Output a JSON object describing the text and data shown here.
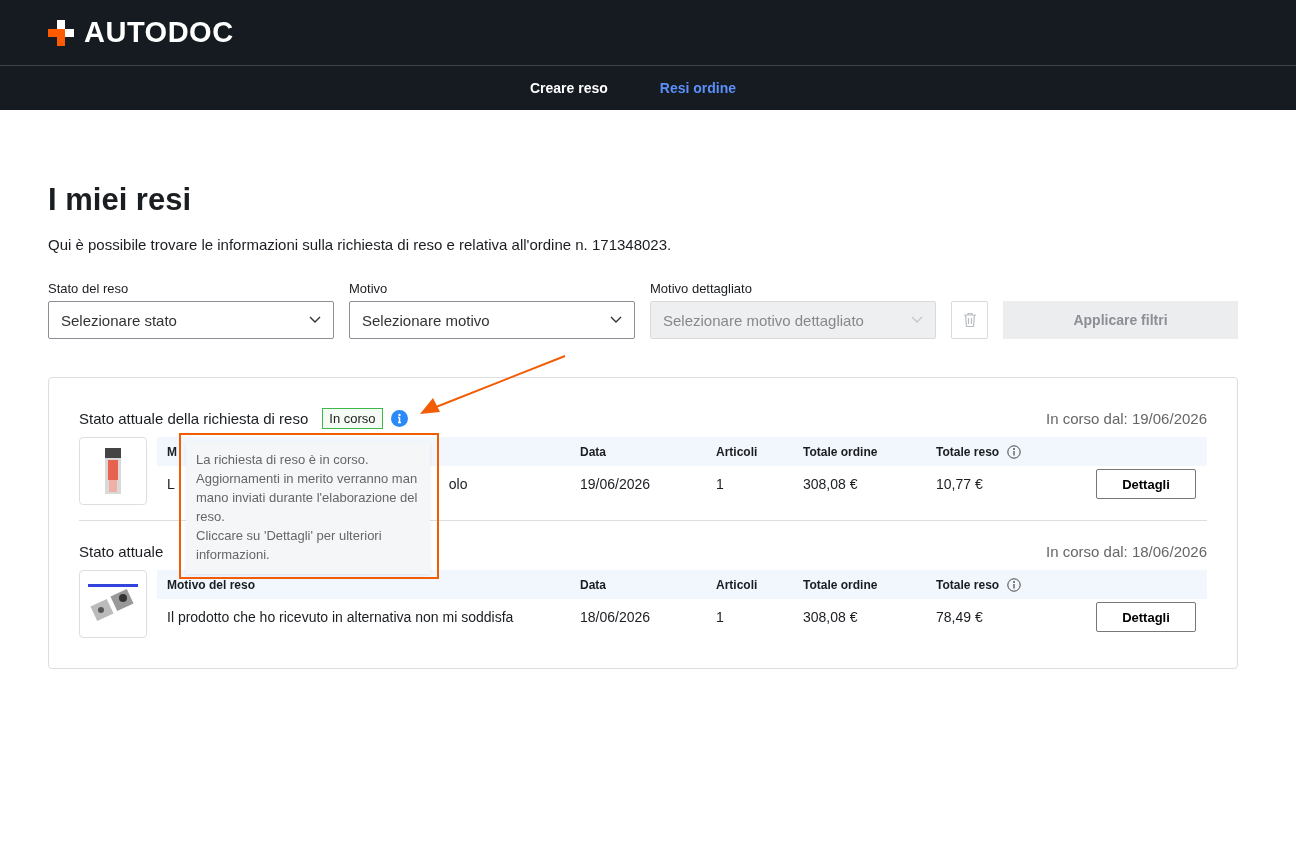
{
  "header": {
    "logo": "AUTODOC"
  },
  "nav": [
    {
      "label": "Creare reso",
      "selected": false
    },
    {
      "label": "Resi ordine",
      "selected": true
    }
  ],
  "page": {
    "title": "I miei resi",
    "description": "Qui è possibile trovare le informazioni sulla richiesta di reso e relativa all'ordine n. 171348023."
  },
  "filters": [
    {
      "label": "Stato del reso",
      "placeholder": "Selezionare stato",
      "disabled": false
    },
    {
      "label": "Motivo",
      "placeholder": "Selezionare motivo",
      "disabled": false
    },
    {
      "label": "Motivo dettagliato",
      "placeholder": "Selezionare motivo dettagliato",
      "disabled": true
    }
  ],
  "clear_button": {
    "disabled": true
  },
  "apply_button": {
    "label": "Applicare filtri",
    "disabled": true
  },
  "returns": [
    {
      "status_title": "Stato attuale della richiesta di reso",
      "status_badge": "In corso",
      "since": "In corso dal: 19/06/2026",
      "columns": [
        "M",
        "Data",
        "Articoli",
        "Totale ordine",
        "Totale reso"
      ],
      "row": {
        "reason": "L",
        "reason_tail": "olo",
        "date": "19/06/2026",
        "items": "1",
        "order_total": "308,08 €",
        "return_total": "10,77 €"
      },
      "button": "Dettagli"
    },
    {
      "status_title": "Stato attuale",
      "since": "In corso dal: 18/06/2026",
      "columns": [
        "Motivo del reso",
        "Data",
        "Articoli",
        "Totale ordine",
        "Totale reso"
      ],
      "row": {
        "reason": "Il prodotto che ho ricevuto in alternativa non mi soddisfa",
        "date": "18/06/2026",
        "items": "1",
        "order_total": "308,08 €",
        "return_total": "78,49 €"
      },
      "button": "Dettagli"
    }
  ],
  "tooltip": {
    "paragraphs": [
      "La richiesta di reso è in corso. Aggiornamenti in merito verranno man mano inviati durante l'elaborazione del reso.",
      "Cliccare su 'Dettagli' per ulteriori informazioni."
    ]
  }
}
